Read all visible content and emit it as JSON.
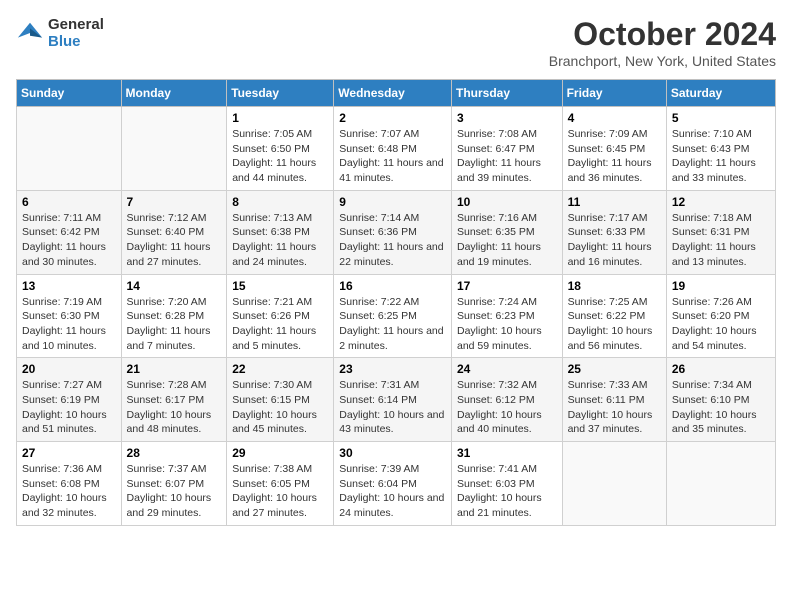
{
  "logo": {
    "line1": "General",
    "line2": "Blue"
  },
  "title": "October 2024",
  "location": "Branchport, New York, United States",
  "days_of_week": [
    "Sunday",
    "Monday",
    "Tuesday",
    "Wednesday",
    "Thursday",
    "Friday",
    "Saturday"
  ],
  "weeks": [
    [
      {
        "day": "",
        "info": ""
      },
      {
        "day": "",
        "info": ""
      },
      {
        "day": "1",
        "info": "Sunrise: 7:05 AM\nSunset: 6:50 PM\nDaylight: 11 hours and 44 minutes."
      },
      {
        "day": "2",
        "info": "Sunrise: 7:07 AM\nSunset: 6:48 PM\nDaylight: 11 hours and 41 minutes."
      },
      {
        "day": "3",
        "info": "Sunrise: 7:08 AM\nSunset: 6:47 PM\nDaylight: 11 hours and 39 minutes."
      },
      {
        "day": "4",
        "info": "Sunrise: 7:09 AM\nSunset: 6:45 PM\nDaylight: 11 hours and 36 minutes."
      },
      {
        "day": "5",
        "info": "Sunrise: 7:10 AM\nSunset: 6:43 PM\nDaylight: 11 hours and 33 minutes."
      }
    ],
    [
      {
        "day": "6",
        "info": "Sunrise: 7:11 AM\nSunset: 6:42 PM\nDaylight: 11 hours and 30 minutes."
      },
      {
        "day": "7",
        "info": "Sunrise: 7:12 AM\nSunset: 6:40 PM\nDaylight: 11 hours and 27 minutes."
      },
      {
        "day": "8",
        "info": "Sunrise: 7:13 AM\nSunset: 6:38 PM\nDaylight: 11 hours and 24 minutes."
      },
      {
        "day": "9",
        "info": "Sunrise: 7:14 AM\nSunset: 6:36 PM\nDaylight: 11 hours and 22 minutes."
      },
      {
        "day": "10",
        "info": "Sunrise: 7:16 AM\nSunset: 6:35 PM\nDaylight: 11 hours and 19 minutes."
      },
      {
        "day": "11",
        "info": "Sunrise: 7:17 AM\nSunset: 6:33 PM\nDaylight: 11 hours and 16 minutes."
      },
      {
        "day": "12",
        "info": "Sunrise: 7:18 AM\nSunset: 6:31 PM\nDaylight: 11 hours and 13 minutes."
      }
    ],
    [
      {
        "day": "13",
        "info": "Sunrise: 7:19 AM\nSunset: 6:30 PM\nDaylight: 11 hours and 10 minutes."
      },
      {
        "day": "14",
        "info": "Sunrise: 7:20 AM\nSunset: 6:28 PM\nDaylight: 11 hours and 7 minutes."
      },
      {
        "day": "15",
        "info": "Sunrise: 7:21 AM\nSunset: 6:26 PM\nDaylight: 11 hours and 5 minutes."
      },
      {
        "day": "16",
        "info": "Sunrise: 7:22 AM\nSunset: 6:25 PM\nDaylight: 11 hours and 2 minutes."
      },
      {
        "day": "17",
        "info": "Sunrise: 7:24 AM\nSunset: 6:23 PM\nDaylight: 10 hours and 59 minutes."
      },
      {
        "day": "18",
        "info": "Sunrise: 7:25 AM\nSunset: 6:22 PM\nDaylight: 10 hours and 56 minutes."
      },
      {
        "day": "19",
        "info": "Sunrise: 7:26 AM\nSunset: 6:20 PM\nDaylight: 10 hours and 54 minutes."
      }
    ],
    [
      {
        "day": "20",
        "info": "Sunrise: 7:27 AM\nSunset: 6:19 PM\nDaylight: 10 hours and 51 minutes."
      },
      {
        "day": "21",
        "info": "Sunrise: 7:28 AM\nSunset: 6:17 PM\nDaylight: 10 hours and 48 minutes."
      },
      {
        "day": "22",
        "info": "Sunrise: 7:30 AM\nSunset: 6:15 PM\nDaylight: 10 hours and 45 minutes."
      },
      {
        "day": "23",
        "info": "Sunrise: 7:31 AM\nSunset: 6:14 PM\nDaylight: 10 hours and 43 minutes."
      },
      {
        "day": "24",
        "info": "Sunrise: 7:32 AM\nSunset: 6:12 PM\nDaylight: 10 hours and 40 minutes."
      },
      {
        "day": "25",
        "info": "Sunrise: 7:33 AM\nSunset: 6:11 PM\nDaylight: 10 hours and 37 minutes."
      },
      {
        "day": "26",
        "info": "Sunrise: 7:34 AM\nSunset: 6:10 PM\nDaylight: 10 hours and 35 minutes."
      }
    ],
    [
      {
        "day": "27",
        "info": "Sunrise: 7:36 AM\nSunset: 6:08 PM\nDaylight: 10 hours and 32 minutes."
      },
      {
        "day": "28",
        "info": "Sunrise: 7:37 AM\nSunset: 6:07 PM\nDaylight: 10 hours and 29 minutes."
      },
      {
        "day": "29",
        "info": "Sunrise: 7:38 AM\nSunset: 6:05 PM\nDaylight: 10 hours and 27 minutes."
      },
      {
        "day": "30",
        "info": "Sunrise: 7:39 AM\nSunset: 6:04 PM\nDaylight: 10 hours and 24 minutes."
      },
      {
        "day": "31",
        "info": "Sunrise: 7:41 AM\nSunset: 6:03 PM\nDaylight: 10 hours and 21 minutes."
      },
      {
        "day": "",
        "info": ""
      },
      {
        "day": "",
        "info": ""
      }
    ]
  ]
}
